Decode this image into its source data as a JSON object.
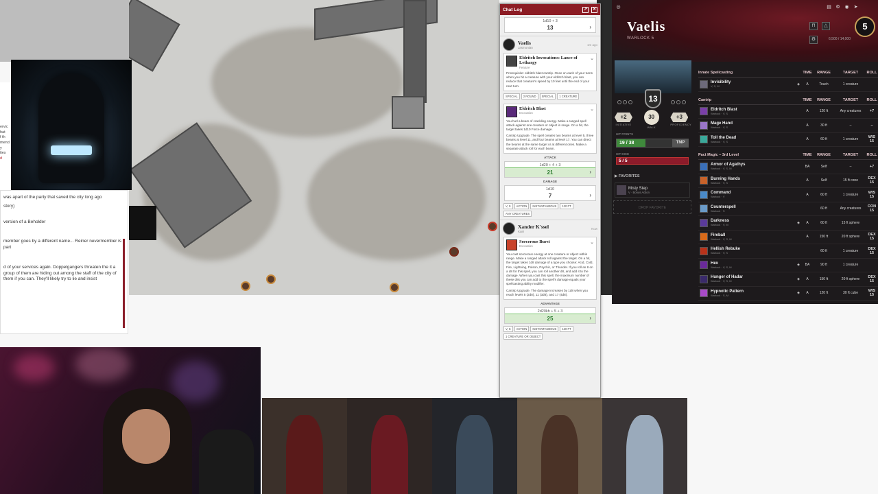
{
  "chat": {
    "title": "Chat Log",
    "popout_icon": "external-link-icon",
    "close_icon": "close-icon",
    "prev_roll": {
      "formula": "1d10 + 3",
      "total": "13"
    },
    "messages": [
      {
        "speaker": "Vaelis",
        "subtitle": "Jasmonian",
        "time": "1m ago",
        "cards": [
          {
            "title": "Eldritch Invocations: Lance of Lethargy",
            "type": "Feature",
            "body": "Prerequisite: eldritch blast cantrip. Once on each of your turns when you hit a creature with your eldritch blast, you can reduce that creature's speed by 10 feet until the end of your next turn.",
            "tags": [
              "SPECIAL",
              "2 ROUND",
              "SPECIAL",
              "1 CREATURE"
            ]
          },
          {
            "title": "Eldritch Blast",
            "type": "Evocation",
            "body": "You hurl a beam of crackling energy. Make a ranged spell attack against one creature or object in range. On a hit, the target takes 1d10 Force damage.",
            "upgrade": "Cantrip Upgrade. The spell creates two beams at level 5, three beams at level 11, and four beams at level 17. You can direct the beams at the same target or at different ones. Make a separate attack roll for each beam.",
            "attack_label": "ATTACK",
            "attack_formula": "1d20 + 4 + 3",
            "attack_total": "21",
            "damage_label": "DAMAGE",
            "damage_formula": "1d10",
            "damage_total": "7",
            "tags": [
              "V, S",
              "ACTION",
              "INSTANTANEOUS",
              "120 FT",
              "ANY CREATURES"
            ]
          }
        ]
      },
      {
        "speaker": "Xander K'ssel",
        "subtitle": "Kairi",
        "time": "Now",
        "cards": [
          {
            "title": "Sorcerous Burst",
            "type": "Evocation",
            "body": "You cast sorcerous energy at one creature or object within range. Make a ranged attack roll against the target. On a hit, the target takes 1d8 damage of a type you choose: Acid, Cold, Fire, Lightning, Poison, Psychic, or Thunder. If you roll an 8 on a d8 for this spell, you can roll another d8, and add it to the damage. When you cast this spell, the maximum number of these d8s you can add to the spell's damage equals your spellcasting ability modifier.",
            "upgrade": "Cantrip Upgrade. The damage increases by 1d8 when you reach levels 5 (2d8), 11 (3d8), and 17 (4d8).",
            "adv_label": "ADVANTAGE",
            "adv_formula": "2d20kh + 5 + 3",
            "adv_total": "25",
            "tags": [
              "V, S",
              "ACTION",
              "INSTANTANEOUS",
              "120 FT",
              "1 CREATURE OR OBJECT"
            ]
          }
        ]
      }
    ]
  },
  "sheet": {
    "name": "Vaelis",
    "class": "WARLOCK 5",
    "level": "5",
    "xp": "6,500 / 14,000",
    "ac": "13",
    "initiative": {
      "value": "+2",
      "label": "INITIATIVE"
    },
    "walk": {
      "value": "30",
      "label": "WALK"
    },
    "proficiency": {
      "value": "+3",
      "label": "PROFICIENCY"
    },
    "hp_label": "HIT POINTS",
    "hp_text": "19 / 38",
    "hp_fraction": 0.5,
    "tmp_label": "TMP",
    "hd_label": "HIT DICE",
    "hd_text": "5 / 5",
    "favorites_title": "FAVORITES",
    "favorite": {
      "name": "Misty Step",
      "sub": "V · Bonus Action"
    },
    "drop_favorite": "DROP FAVORITE",
    "columns": {
      "time": "TIME",
      "range": "RANGE",
      "target": "TARGET",
      "roll": "ROLL"
    },
    "sections": [
      {
        "title": "Innate Spellcasting",
        "spells": [
          {
            "name": "Invisibility",
            "sub": "V, S, M",
            "time": "A",
            "range": "Touch",
            "target": "1 creature",
            "roll": "",
            "conc": true,
            "color": "#6d6a7a"
          }
        ]
      },
      {
        "title": "Cantrip",
        "spells": [
          {
            "name": "Eldritch Blast",
            "sub": "Warlock · V, S",
            "time": "A",
            "range": "120 ft",
            "target": "Any creatures",
            "roll": "+7",
            "conc": false,
            "color": "#7a3fa8"
          },
          {
            "name": "Mage Hand",
            "sub": "Warlock · V, S",
            "time": "A",
            "range": "30 ft",
            "target": "–",
            "roll": "–",
            "conc": false,
            "color": "#9a76c8"
          },
          {
            "name": "Toll the Dead",
            "sub": "Warlock · V, S",
            "time": "A",
            "range": "60 ft",
            "target": "1 creature",
            "roll": "WIS 15",
            "conc": false,
            "color": "#3aa89a"
          }
        ]
      },
      {
        "title": "Pact Magic – 3rd Level",
        "spells": [
          {
            "name": "Armor of Agathys",
            "sub": "Warlock · V, S, M",
            "time": "BA",
            "range": "Self",
            "target": "–",
            "roll": "+7",
            "conc": false,
            "color": "#3a6fb8"
          },
          {
            "name": "Burning Hands",
            "sub": "Warlock · V, S",
            "time": "A",
            "range": "Self",
            "target": "15 ft cone",
            "roll": "DEX 15",
            "conc": false,
            "color": "#c8622a"
          },
          {
            "name": "Command",
            "sub": "Warlock · V",
            "time": "A",
            "range": "60 ft",
            "target": "1 creature",
            "roll": "WIS 15",
            "conc": false,
            "color": "#4a8ac8"
          },
          {
            "name": "Counterspell",
            "sub": "Warlock · S",
            "time": "",
            "range": "60 ft",
            "target": "Any creatures",
            "roll": "CON 15",
            "conc": false,
            "color": "#6a9ac8"
          },
          {
            "name": "Darkness",
            "sub": "Warlock · V, M",
            "time": "A",
            "range": "60 ft",
            "target": "15 ft sphere",
            "roll": "",
            "conc": true,
            "color": "#5a3a9a"
          },
          {
            "name": "Fireball",
            "sub": "Warlock · V, S, M",
            "time": "A",
            "range": "150 ft",
            "target": "20 ft sphere",
            "roll": "DEX 15",
            "conc": false,
            "color": "#d86a1a"
          },
          {
            "name": "Hellish Rebuke",
            "sub": "Warlock · V, S",
            "time": "",
            "range": "60 ft",
            "target": "1 creature",
            "roll": "DEX 15",
            "conc": false,
            "color": "#b8321a"
          },
          {
            "name": "Hex",
            "sub": "Warlock · V, S, M",
            "time": "BA",
            "range": "90 ft",
            "target": "1 creature",
            "roll": "",
            "conc": true,
            "color": "#6a2a9a"
          },
          {
            "name": "Hunger of Hadar",
            "sub": "Warlock · V, S, M",
            "time": "A",
            "range": "150 ft",
            "target": "20 ft sphere",
            "roll": "DEX 15",
            "conc": true,
            "color": "#3a2a6a"
          },
          {
            "name": "Hypnotic Pattern",
            "sub": "Warlock · S, M",
            "time": "A",
            "range": "120 ft",
            "target": "30 ft cube",
            "roll": "WIS 15",
            "conc": true,
            "color": "#a84ac8"
          }
        ]
      }
    ]
  },
  "notes": {
    "lines": [
      "was apart of the party that saved the city long ago",
      "story)",
      "version of a Beholder",
      "member goes by a different name... Reiner nevermember is part",
      "d of your services again. Doppelgangers threaten the it a group of them are hiding out among the staff of the city of them if you can. They'll likely try to lie and insist"
    ],
    "side_lines": [
      "ervic",
      "hat",
      "f th",
      "mend",
      "y",
      "ties",
      "d"
    ]
  }
}
